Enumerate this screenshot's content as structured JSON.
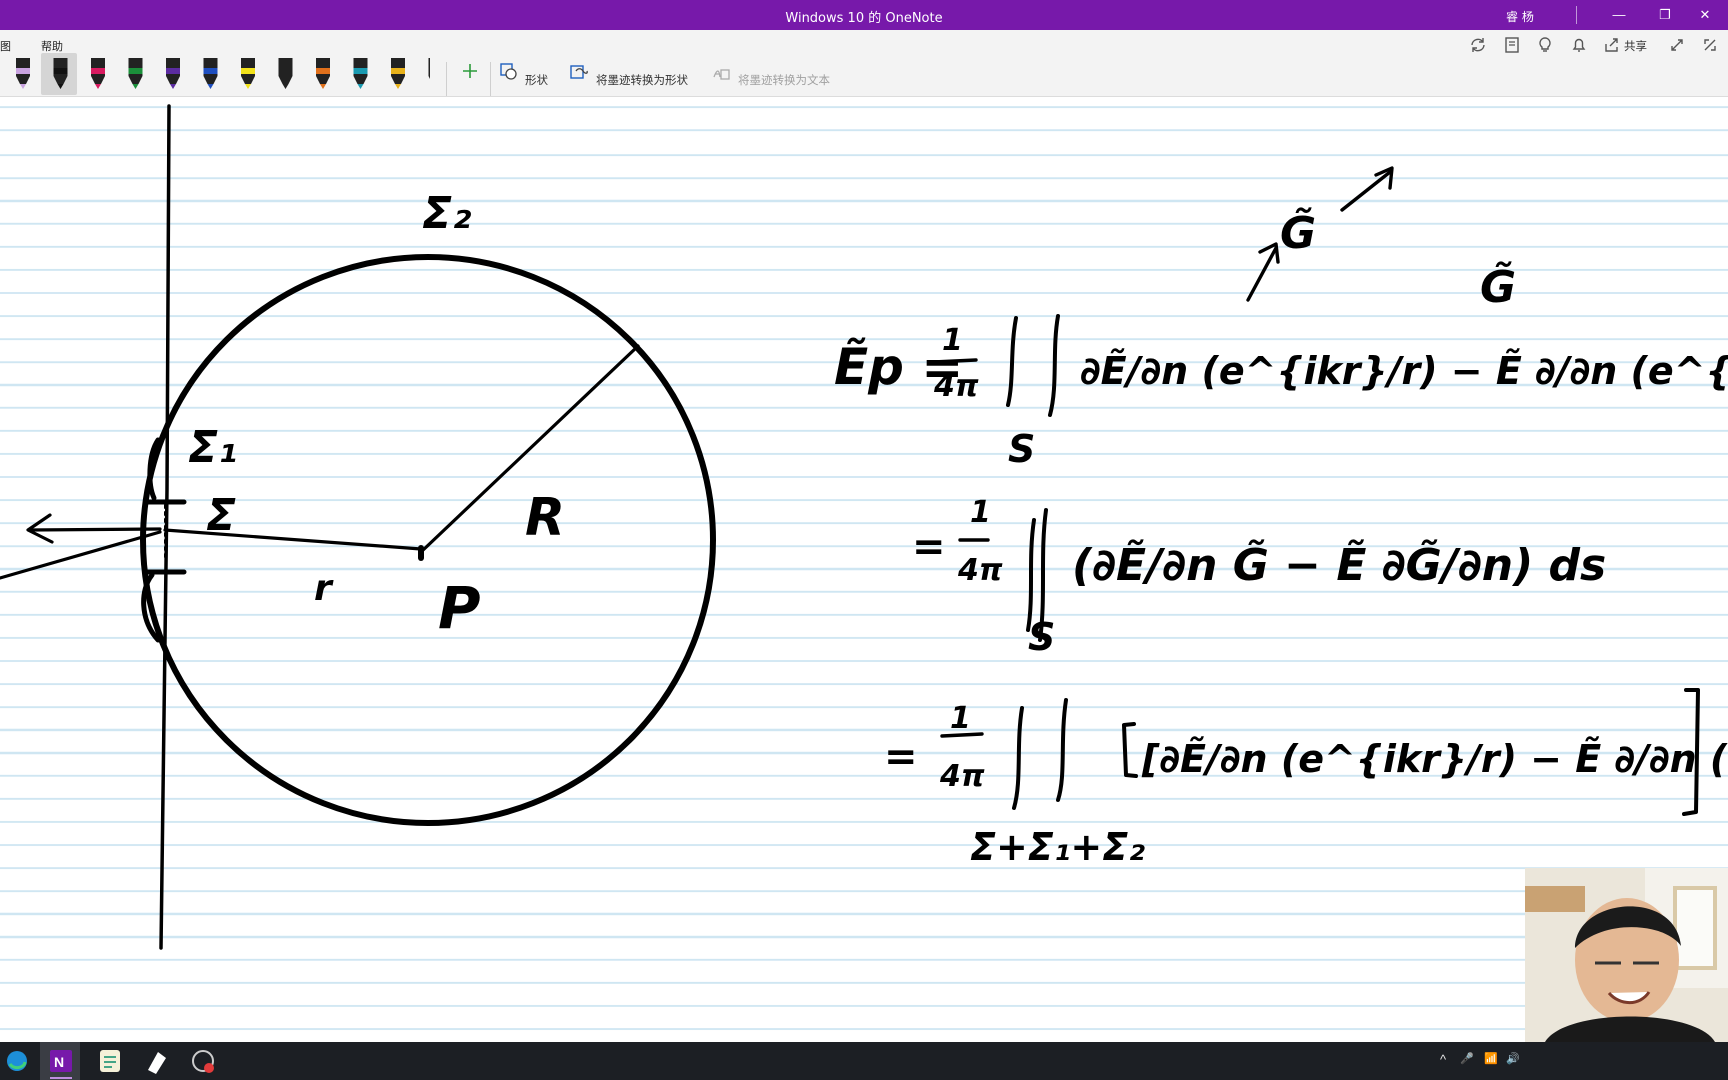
{
  "window": {
    "title": "Windows 10 的 OneNote",
    "user": "睿 杨",
    "controls": [
      "—",
      "❐",
      "✕"
    ]
  },
  "ribbon": {
    "menu": [
      "图",
      "帮助"
    ],
    "shapes_label": "形状",
    "ink_to_shape_label": "将墨迹转换为形状",
    "ink_to_text_label": "将墨迹转换为文本",
    "share_label": "共享",
    "pens": [
      {
        "name": "pen-highlighter-purple",
        "color": "#c9a3e0"
      },
      {
        "name": "pen-black",
        "color": "#111111"
      },
      {
        "name": "pen-magenta",
        "color": "#d81b60"
      },
      {
        "name": "pen-green",
        "color": "#1b8f3a"
      },
      {
        "name": "pen-violet",
        "color": "#5b2ca0"
      },
      {
        "name": "pen-blue",
        "color": "#1f4fbf"
      },
      {
        "name": "pen-yellow",
        "color": "#f2e21b"
      },
      {
        "name": "pen-galaxy",
        "color": "#222222"
      },
      {
        "name": "pen-orange",
        "color": "#e0701b"
      },
      {
        "name": "pen-teal",
        "color": "#1a9ab0"
      },
      {
        "name": "pen-gold",
        "color": "#e8b21b"
      },
      {
        "name": "pen-dark",
        "color": "#222222"
      }
    ]
  },
  "colors": {
    "accent": "#7719aa",
    "ink": "#000000",
    "rule_lines": "#cfe6f2",
    "taskbar": "#1c1f24"
  },
  "ink_text": {
    "sigma2": "Σ₂",
    "sigma1": "Σ₁",
    "sigma": "Σ",
    "R": "R",
    "r": "r",
    "P": "P",
    "G_tilde_1": "G̃",
    "G_tilde_2": "G̃",
    "eq1_lhs": "Ẽp = ",
    "frac_num": "1",
    "frac_den": "4π",
    "eq1_term1": "∂Ẽ/∂n (e^{ikr}/r) − Ẽ ∂/∂n (e^{ikr}/r) ds",
    "eq1_sub": "S",
    "eq2_body": "(∂Ẽ/∂n G̃ − Ẽ ∂G̃/∂n) ds",
    "eq2_sub": "S",
    "eq3_body": "[∂Ẽ/∂n (e^{ikr}/r) − Ẽ ∂/∂n (e^{ikr}/r)] ds",
    "eq3_sub": "Σ+Σ₁+Σ₂"
  },
  "taskbar": {
    "apps": [
      "edge-icon",
      "onenote-icon",
      "notes-icon",
      "pen-app-icon",
      "recorder-icon"
    ],
    "tray": [
      "^",
      "🎤",
      "📶",
      "🔊"
    ]
  }
}
